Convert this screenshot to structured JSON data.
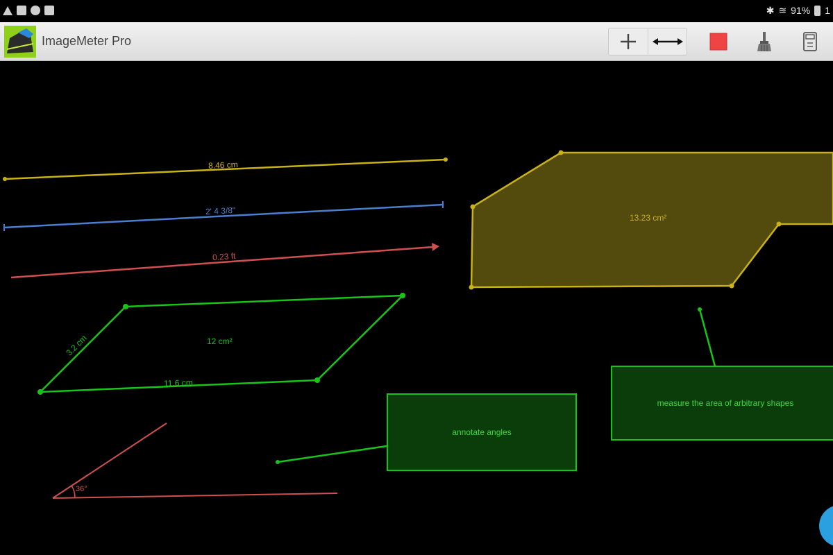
{
  "status_bar": {
    "battery_text": "91%",
    "trailing_text": "1",
    "left_icons": [
      "warning-icon",
      "gallery-icon",
      "messenger-icon",
      "briefcase-icon"
    ],
    "right_icons": [
      "bluetooth-icon",
      "wifi-icon",
      "battery-icon"
    ]
  },
  "app_bar": {
    "title": "ImageMeter Pro",
    "tools": [
      "add-icon",
      "measure-arrow-icon",
      "color-swatch-icon",
      "brush-icon",
      "calculator-icon"
    ],
    "accent_color": "#ee4444"
  },
  "canvas": {
    "measurements": {
      "yellow_line": "8.46 cm",
      "blue_line": "2' 4 3/8\"",
      "red_line": "0.23 ft",
      "parallelogram_area": "12 cm²",
      "parallelogram_side": "3.2 cm",
      "parallelogram_base": "11.6 cm",
      "polygon_area": "13.23 cm²",
      "angle": "36°"
    },
    "callouts": {
      "angles": "annotate angles",
      "area": "measure the area of arbitrary shapes"
    },
    "colors": {
      "yellow": "#c8b21a",
      "blue": "#4a7fd0",
      "red": "#d05050",
      "green": "#19c419",
      "polygon_fill": "#5c5210"
    }
  }
}
